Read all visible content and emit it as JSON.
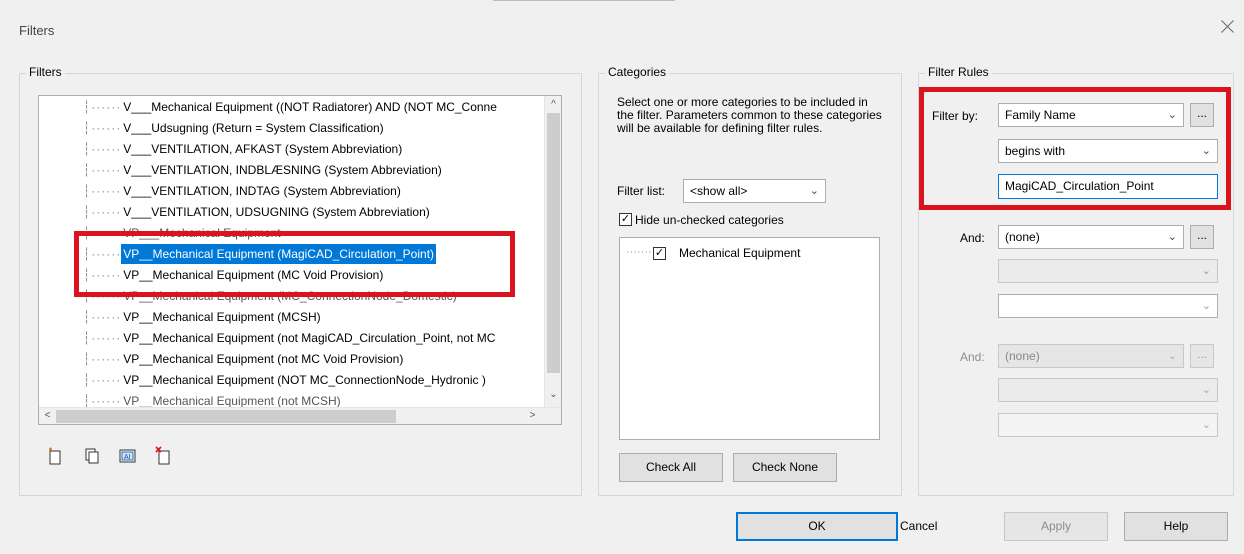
{
  "window": {
    "title": "Filters"
  },
  "filters_group": {
    "label": "Filters",
    "items": [
      "V___Mechanical Equipment ((NOT Radiatorer) AND (NOT MC_Conne",
      "V___Udsugning (Return = System Classification)",
      "V___VENTILATION, AFKAST (System Abbreviation)",
      "V___VENTILATION, INDBLÆSNING (System Abbreviation)",
      "V___VENTILATION, INDTAG (System Abbreviation)",
      "V___VENTILATION, UDSUGNING (System Abbreviation)",
      "VP___Mechanical Equipment",
      "VP__Mechanical Equipment (MagiCAD_Circulation_Point)",
      "VP__Mechanical Equipment (MC Void Provision)",
      "VP__Mechanical Equipment (MC_ConnectionNode_Domestic)",
      "VP__Mechanical Equipment (MCSH)",
      "VP__Mechanical Equipment (not MagiCAD_Circulation_Point, not MC",
      "VP__Mechanical Equipment (not MC Void Provision)",
      "VP__Mechanical Equipment (NOT MC_ConnectionNode_Hydronic )",
      "VP__Mechanical Equipment (not MCSH)"
    ],
    "selected_index": 7,
    "tools": [
      "new-filter-icon",
      "duplicate-filter-icon",
      "rename-filter-icon",
      "delete-filter-icon"
    ]
  },
  "categories_group": {
    "label": "Categories",
    "description": "Select one or more categories to be included in the filter.  Parameters common to these categories will be available for defining filter rules.",
    "filter_list_label": "Filter list:",
    "filter_list_value": "<show all>",
    "hide_unchecked_label": "Hide un-checked categories",
    "hide_unchecked_checked": true,
    "category_items": [
      {
        "label": "Mechanical Equipment",
        "checked": true
      }
    ],
    "check_all_label": "Check All",
    "check_none_label": "Check None"
  },
  "filter_rules_group": {
    "label": "Filter Rules",
    "filter_by_label": "Filter by:",
    "filter_by_value": "Family Name",
    "operator_value": "begins with",
    "rule_value": "MagiCAD_Circulation_Point",
    "and1_label": "And:",
    "and1_value": "(none)",
    "and2_label": "And:",
    "and2_value": "(none)",
    "more_label": "..."
  },
  "footer": {
    "ok_label": "OK",
    "cancel_label": "Cancel",
    "apply_label": "Apply",
    "help_label": "Help"
  },
  "colors": {
    "highlight": "#d9141f",
    "selection": "#0078d7"
  }
}
